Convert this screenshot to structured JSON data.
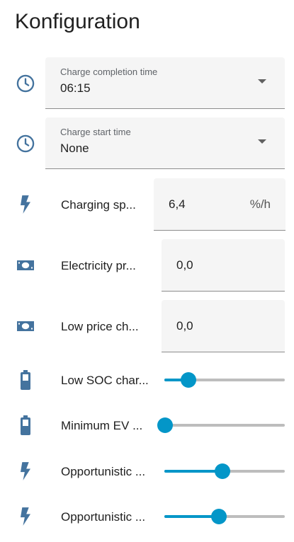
{
  "page_title": "Konfiguration",
  "colors": {
    "icon": "#44739e",
    "accent": "#0396c8"
  },
  "selects": [
    {
      "icon": "clock-icon",
      "label": "Charge completion time",
      "value": "06:15"
    },
    {
      "icon": "clock-icon",
      "label": "Charge start time",
      "value": "None"
    }
  ],
  "number_rows": [
    {
      "icon": "lightning-bolt-icon",
      "label": "Charging sp...",
      "value": "6,4",
      "unit": "%/h"
    },
    {
      "icon": "cash-icon",
      "label": "Electricity pr...",
      "value": "0,0"
    },
    {
      "icon": "cash-icon",
      "label": "Low price ch...",
      "value": "0,0"
    }
  ],
  "slider_rows": [
    {
      "icon": "battery-icon",
      "label": "Low SOC char...",
      "level": 0.2
    },
    {
      "icon": "battery-icon",
      "label": "Minimum EV ...",
      "level": 0.0
    },
    {
      "icon": "lightning-bolt-icon",
      "label": "Opportunistic ...",
      "level": 0.48
    },
    {
      "icon": "lightning-bolt-icon",
      "label": "Opportunistic ...",
      "level": 0.45
    }
  ]
}
